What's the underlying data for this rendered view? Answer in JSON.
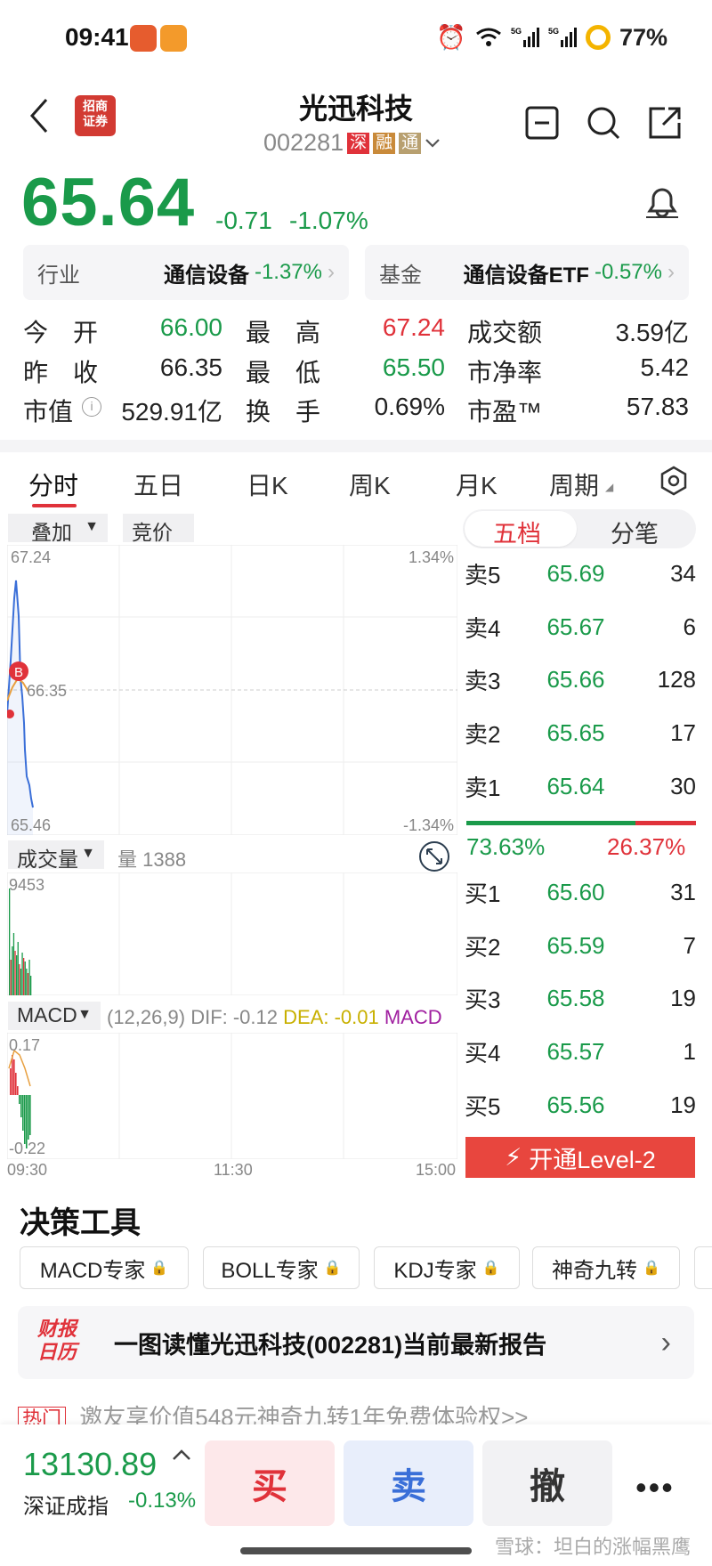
{
  "status": {
    "time": "09:41",
    "battery": "77%"
  },
  "header": {
    "title": "光迅科技",
    "code": "002281",
    "tags": [
      "深",
      "融",
      "通"
    ]
  },
  "quote": {
    "price": "65.64",
    "change": "-0.71",
    "change_pct": "-1.07%"
  },
  "industry": {
    "label": "行业",
    "name": "通信设备",
    "pct": "-1.37%"
  },
  "fund": {
    "label": "基金",
    "name": "通信设备ETF",
    "pct": "-0.57%"
  },
  "stats": [
    {
      "l1": "今　开",
      "v1": "66.00",
      "l2": "最　高",
      "v2": "67.24",
      "l3": "成交额",
      "v3": "3.59亿"
    },
    {
      "l1": "昨　收",
      "v1": "66.35",
      "l2": "最　低",
      "v2": "65.50",
      "l3": "市净率",
      "v3": "5.42"
    },
    {
      "l1": "市值",
      "v1": "529.91亿",
      "l2": "换　手",
      "v2": "0.69%",
      "l3": "市盈™",
      "v3": "57.83"
    }
  ],
  "tabs": [
    "分时",
    "五日",
    "日K",
    "周K",
    "月K",
    "周期"
  ],
  "chart_controls": {
    "overlay": "叠加",
    "auction": "竞价"
  },
  "chart_data": [
    {
      "type": "line",
      "title": "",
      "ylim": [
        65.46,
        67.24
      ],
      "y_ticks": [
        "67.24",
        "66.35",
        "65.46"
      ],
      "y_right_ticks": [
        "1.34%",
        "-1.34%"
      ],
      "marker": "B"
    },
    {
      "type": "bar",
      "title": "成交量",
      "label": "量 1388",
      "ymax": "9453"
    },
    {
      "type": "bar",
      "title": "MACD",
      "params": "(12,26,9)",
      "dif": "DIF: -0.12",
      "dea": "DEA: -0.01",
      "macd": "MACD",
      "y_ticks": [
        "0.17",
        "-0.22"
      ],
      "x_ticks": [
        "09:30",
        "11:30",
        "15:00"
      ]
    }
  ],
  "orderbook": {
    "tabs": [
      "五档",
      "分笔"
    ],
    "asks": [
      {
        "label": "卖5",
        "price": "65.69",
        "qty": "34"
      },
      {
        "label": "卖4",
        "price": "65.67",
        "qty": "6"
      },
      {
        "label": "卖3",
        "price": "65.66",
        "qty": "128"
      },
      {
        "label": "卖2",
        "price": "65.65",
        "qty": "17"
      },
      {
        "label": "卖1",
        "price": "65.64",
        "qty": "30"
      }
    ],
    "ratio_buy": "73.63%",
    "ratio_sell": "26.37%",
    "buy_ratio_value": 0.7363,
    "bids": [
      {
        "label": "买1",
        "price": "65.60",
        "qty": "31"
      },
      {
        "label": "买2",
        "price": "65.59",
        "qty": "7"
      },
      {
        "label": "买3",
        "price": "65.58",
        "qty": "19"
      },
      {
        "label": "买4",
        "price": "65.57",
        "qty": "1"
      },
      {
        "label": "买5",
        "price": "65.56",
        "qty": "19"
      }
    ],
    "level2": "开通Level-2"
  },
  "tools": {
    "title": "决策工具",
    "items": [
      "MACD专家",
      "BOLL专家",
      "KDJ专家",
      "神奇九转"
    ]
  },
  "report": {
    "badge": "财报日历",
    "text": "一图读懂光迅科技(002281)当前最新报告"
  },
  "promo": {
    "tag": "热门",
    "text": "邀友享价值548元神奇九转1年免费体验权>>"
  },
  "bottom": {
    "index_value": "13130.89",
    "index_name": "深证成指",
    "index_pct": "-0.13%",
    "buy": "买",
    "sell": "卖",
    "cancel": "撤",
    "watermark": "雪球：坦白的涨幅黑鹰"
  }
}
